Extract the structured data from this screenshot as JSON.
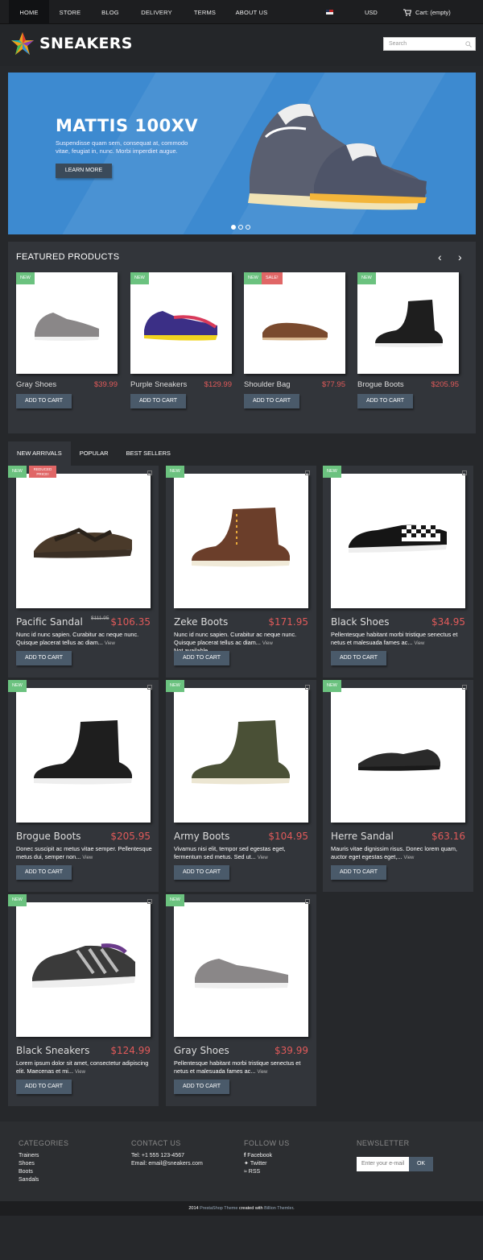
{
  "nav": {
    "items": [
      "HOME",
      "STORE",
      "BLOG",
      "DELIVERY",
      "TERMS",
      "ABOUT US"
    ],
    "currency": "USD",
    "cart": "Cart: (empty)"
  },
  "header": {
    "logo": "SNEAKERS",
    "search_placeholder": "Search"
  },
  "hero": {
    "title": "MATTIS 100XV",
    "text": "Suspendisse quam sem, consequat at, commodo vitae, feugiat in, nunc. Morbi imperdiet augue.",
    "button": "LEARN MORE"
  },
  "featured": {
    "title": "FEATURED PRODUCTS",
    "add": "ADD TO CART",
    "new": "NEW",
    "sale": "SALE!",
    "items": [
      {
        "name": "Gray Shoes",
        "price": "$39.99"
      },
      {
        "name": "Purple Sneakers",
        "price": "$129.99"
      },
      {
        "name": "Shoulder Bag",
        "price": "$77.95"
      },
      {
        "name": "Brogue Boots",
        "price": "$205.95"
      }
    ]
  },
  "tabs": [
    "NEW ARRIVALS",
    "POPULAR",
    "BEST SELLERS"
  ],
  "products": {
    "add": "ADD TO CART",
    "new": "NEW",
    "reduced": "REDUCED PRICE!",
    "view": "View",
    "not_available": "Not available",
    "items": [
      {
        "name": "Pacific Sandal",
        "price": "$106.35",
        "old": "$111.95",
        "desc": "Nunc id nunc sapien. Curabitur ac neque nunc. Quisque placerat tellus ac diam..."
      },
      {
        "name": "Zeke Boots",
        "price": "$171.95",
        "desc": "Nunc id nunc sapien. Curabitur ac neque nunc. Quisque placerat tellus ac diam..."
      },
      {
        "name": "Black Shoes",
        "price": "$34.95",
        "desc": "Pellentesque habitant morbi tristique senectus et netus et malesuada fames ac..."
      },
      {
        "name": "Brogue Boots",
        "price": "$205.95",
        "desc": "Donec suscipit ac metus vitae semper. Pellentesque metus dui, semper non..."
      },
      {
        "name": "Army Boots",
        "price": "$104.95",
        "desc": "Vivamus nisi elit, tempor sed egestas eget, fermentum sed metus. Sed ut..."
      },
      {
        "name": "Herre Sandal",
        "price": "$63.16",
        "desc": "Mauris vitae dignissim risus. Donec lorem quam, auctor eget egestas eget,..."
      },
      {
        "name": "Black Sneakers",
        "price": "$124.99",
        "desc": "Lorem ipsum dolor sit amet, consectetur adipiscing elit. Maecenas et mi..."
      },
      {
        "name": "Gray Shoes",
        "price": "$39.99",
        "desc": "Pellentesque habitant morbi tristique senectus et netus et malesuada fames ac..."
      }
    ]
  },
  "footer": {
    "categories": {
      "title": "CATEGORIES",
      "items": [
        "Trainers",
        "Shoes",
        "Boots",
        "Sandals"
      ]
    },
    "contact": {
      "title": "CONTACT US",
      "tel_label": "Tel:",
      "tel": "+1 555 123-4567",
      "email_label": "Email:",
      "email": "email@sneakers.com"
    },
    "follow": {
      "title": "FOLLOW US",
      "items": [
        "Facebook",
        "Twitter",
        "RSS"
      ]
    },
    "newsletter": {
      "title": "NEWSLETTER",
      "placeholder": "Enter your e-mail",
      "button": "OK"
    },
    "copyright": {
      "year": "2014",
      "theme": "PrestaShop Theme",
      "mid": "created with",
      "author": "Billion Themler"
    }
  },
  "colors": {
    "accent_price": "#e05a5a",
    "badge_new": "#6bc27f",
    "hero_bg": "#3d8ad0",
    "button": "#4a5a6a"
  }
}
